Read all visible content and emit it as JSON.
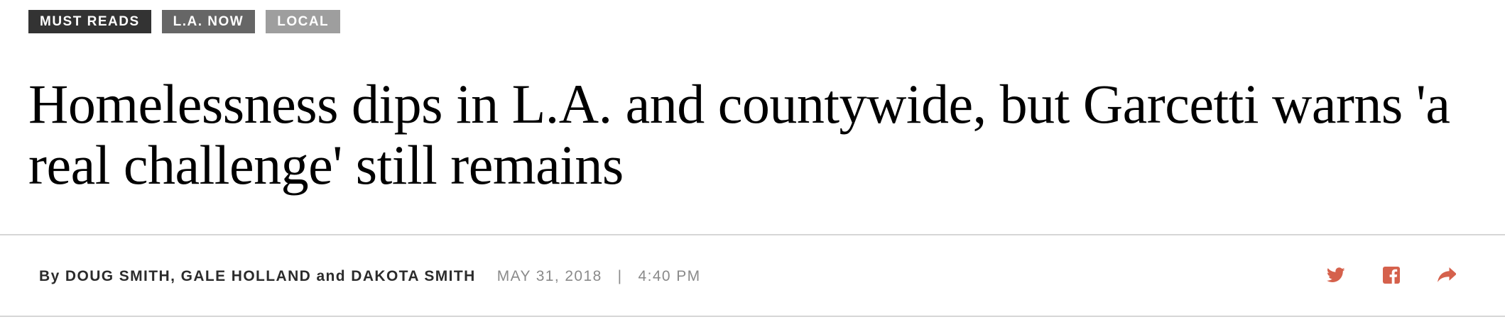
{
  "tags": [
    {
      "label": "MUST READS"
    },
    {
      "label": "L.A. NOW"
    },
    {
      "label": "LOCAL"
    }
  ],
  "headline": "Homelessness dips in L.A. and countywide, but Garcetti warns 'a real challenge' still remains",
  "byline": {
    "prefix": "By",
    "author1": "DOUG SMITH",
    "comma": ",",
    "author2": "GALE HOLLAND",
    "conjunction": "and",
    "author3": "DAKOTA SMITH"
  },
  "meta": {
    "date": "MAY 31, 2018",
    "separator": "|",
    "time": "4:40 PM"
  },
  "share": {
    "icons": [
      "twitter-icon",
      "facebook-icon",
      "share-arrow-icon"
    ],
    "color": "#d5614c"
  },
  "colors": {
    "tag_dark": "#333333",
    "tag_mid": "#666666",
    "tag_light": "#9e9e9e",
    "rule": "#d6d6d6",
    "meta_gray": "#8a8a8a"
  }
}
